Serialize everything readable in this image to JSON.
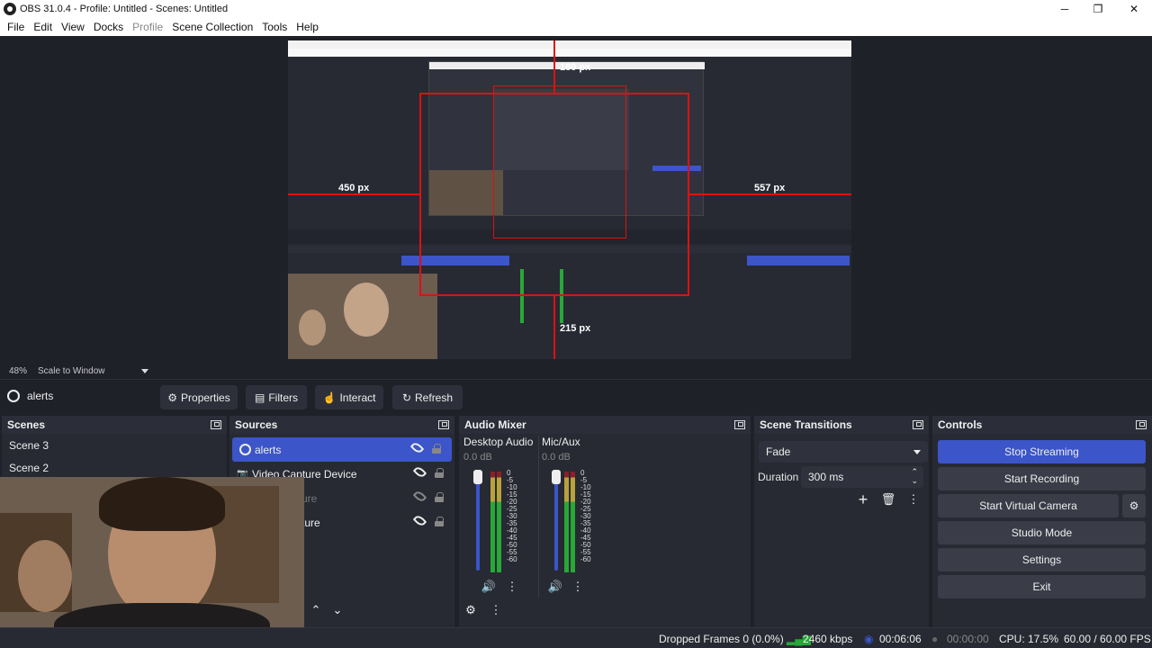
{
  "window": {
    "title": "OBS 31.0.4 - Profile: Untitled - Scenes: Untitled",
    "minimize": "─",
    "maximize": "❐",
    "close": "✕"
  },
  "menu": {
    "items": [
      "File",
      "Edit",
      "View",
      "Docks",
      "Profile",
      "Scene Collection",
      "Tools",
      "Help"
    ]
  },
  "preview": {
    "zoom": "48%",
    "mode": "Scale to Window",
    "labels": {
      "top": "180 px",
      "left": "450 px",
      "right": "557 px",
      "bottom": "215 px"
    }
  },
  "source_toolbar": {
    "selected_source": "alerts",
    "properties": "Properties",
    "filters": "Filters",
    "interact": "Interact",
    "refresh": "Refresh"
  },
  "scenes": {
    "title": "Scenes",
    "items": [
      "Scene 3",
      "Scene 2"
    ]
  },
  "sources": {
    "title": "Sources",
    "items": [
      {
        "name": "alerts",
        "selected": true
      },
      {
        "name": "Video Capture Device",
        "selected": false
      },
      {
        "name": "pture",
        "selected": false
      },
      {
        "name": "ture",
        "selected": false
      }
    ]
  },
  "audio_mixer": {
    "title": "Audio Mixer",
    "channels": [
      {
        "name": "Desktop Audio",
        "db": "0.0 dB"
      },
      {
        "name": "Mic/Aux",
        "db": "0.0 dB"
      }
    ],
    "scale": [
      "0",
      "-5",
      "-10",
      "-15",
      "-20",
      "-25",
      "-30",
      "-35",
      "-40",
      "-45",
      "-50",
      "-55",
      "-60"
    ]
  },
  "scene_transitions": {
    "title": "Scene Transitions",
    "transition": "Fade",
    "duration_label": "Duration",
    "duration_value": "300 ms"
  },
  "controls": {
    "title": "Controls",
    "stop_streaming": "Stop Streaming",
    "start_recording": "Start Recording",
    "start_virtual_camera": "Start Virtual Camera",
    "studio_mode": "Studio Mode",
    "settings": "Settings",
    "exit": "Exit"
  },
  "status": {
    "dropped_frames": "Dropped Frames 0 (0.0%)",
    "bitrate": "2460 kbps",
    "stream_time": "00:06:06",
    "record_time": "00:00:00",
    "cpu": "CPU: 17.5%",
    "fps": "60.00 / 60.00 FPS"
  },
  "colors": {
    "accent": "#3c55c8",
    "guide": "#e01010",
    "background": "#1f2129"
  }
}
